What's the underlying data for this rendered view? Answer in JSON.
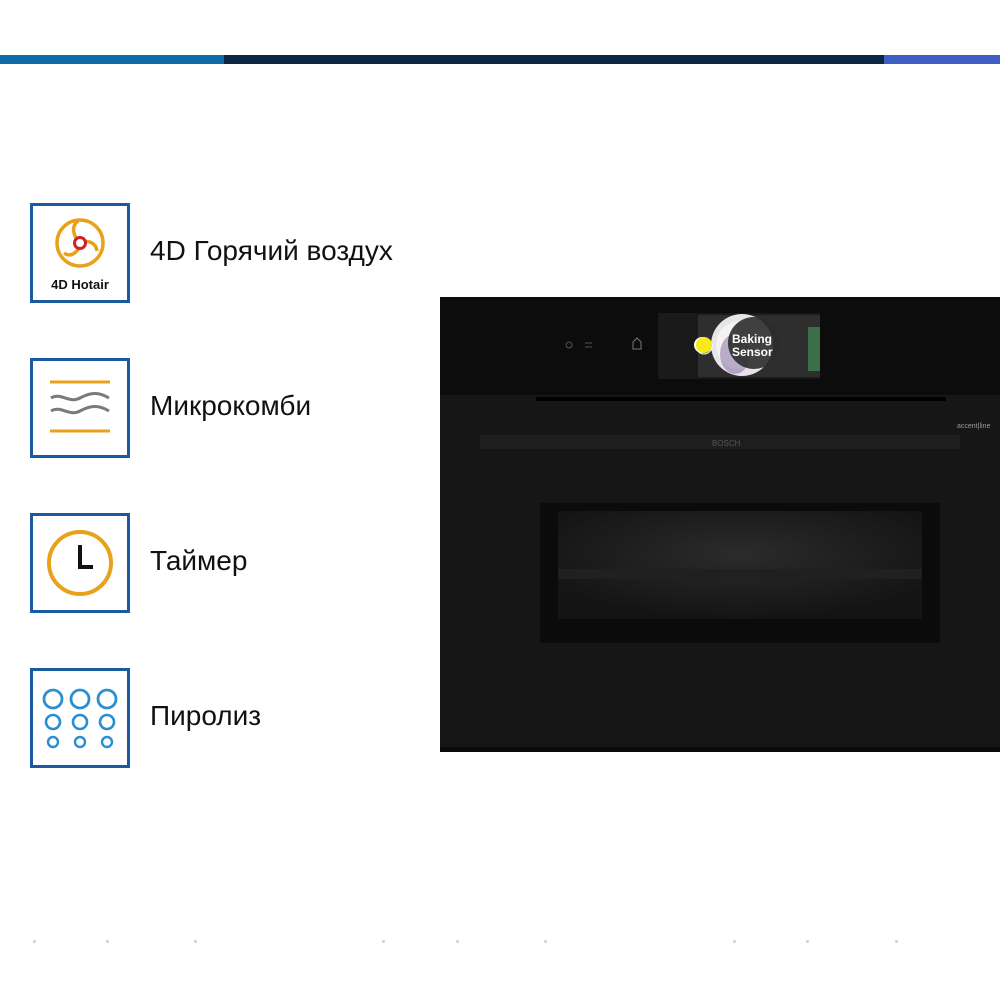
{
  "features": [
    {
      "id": "hotair",
      "label": "4D Горячий воздух",
      "icon": "4d-hotair-fan-icon",
      "icon_text": "4D Hotair"
    },
    {
      "id": "microcombi",
      "label": "Микрокомби",
      "icon": "microwave-waves-icon"
    },
    {
      "id": "timer",
      "label": "Таймер",
      "icon": "clock-icon"
    },
    {
      "id": "pyrolysis",
      "label": "Пиролиз",
      "icon": "pyrolysis-circles-icon"
    }
  ],
  "oven": {
    "display_text_line1": "Baking",
    "display_text_line2": "Sensor",
    "brand": "BOSCH",
    "series": "accent|line"
  },
  "colors": {
    "accent_orange": "#e8a21a",
    "frame_blue": "#1b5aa0",
    "icon_red": "#d0202a",
    "icon_blue": "#2a8fd0"
  }
}
